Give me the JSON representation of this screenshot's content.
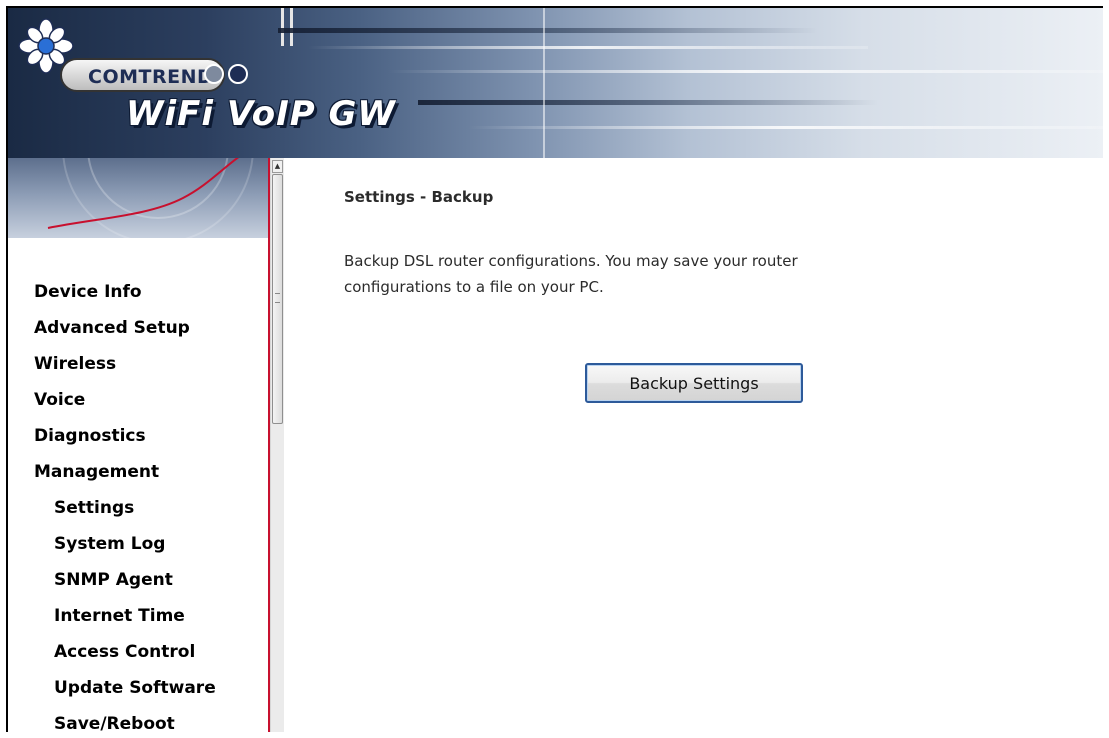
{
  "banner": {
    "brand": "COMTREND",
    "product": "WiFi VoIP GW"
  },
  "nav": {
    "items": [
      {
        "label": "Device Info",
        "level": "top"
      },
      {
        "label": "Advanced Setup",
        "level": "top"
      },
      {
        "label": "Wireless",
        "level": "top"
      },
      {
        "label": "Voice",
        "level": "top"
      },
      {
        "label": "Diagnostics",
        "level": "top"
      },
      {
        "label": "Management",
        "level": "top"
      },
      {
        "label": "Settings",
        "level": "sub"
      },
      {
        "label": "System Log",
        "level": "sub"
      },
      {
        "label": "SNMP Agent",
        "level": "sub"
      },
      {
        "label": "Internet Time",
        "level": "sub"
      },
      {
        "label": "Access Control",
        "level": "sub"
      },
      {
        "label": "Update Software",
        "level": "sub"
      },
      {
        "label": "Save/Reboot",
        "level": "sub"
      }
    ]
  },
  "main": {
    "title": "Settings - Backup",
    "description": "Backup DSL router configurations. You may save your router configurations to a file on your PC.",
    "backup_button": "Backup Settings"
  },
  "colors": {
    "nav_border": "#c8102e",
    "button_border": "#2d5a9a",
    "product_text": "#ffffff"
  }
}
